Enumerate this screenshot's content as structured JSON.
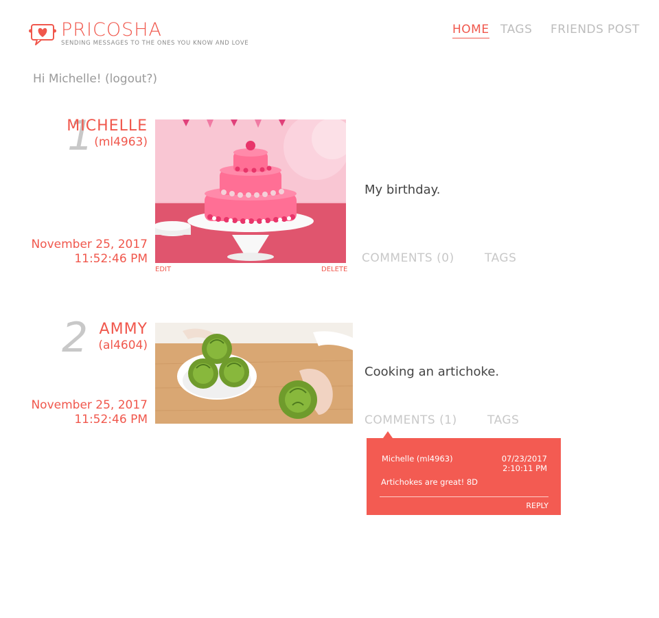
{
  "brand": {
    "name": "PRICOSHA",
    "tagline": "Sending messages to the ones you know and love",
    "icon": "chat-heart-icon",
    "accent_color": "#f0574c"
  },
  "nav": {
    "home": "HOME",
    "tags": "TAGS",
    "friends": "FRIENDS",
    "post": "POST"
  },
  "greeting": {
    "text": "Hi Michelle! ",
    "logout": "(logout?)"
  },
  "posts": [
    {
      "number": "1",
      "name": "MICHELLE",
      "username": "(ml4963)",
      "date": "November 25, 2017",
      "time": "11:52:46 PM",
      "image": "pink-birthday-cake-photo",
      "caption": "My birthday.",
      "edit_label": "EDIT",
      "delete_label": "DELETE",
      "comments_label": "COMMENTS (0)",
      "tags_label": "TAGS"
    },
    {
      "number": "2",
      "name": "AMMY",
      "username": "(al4604)",
      "date": "November 25, 2017",
      "time": "11:52:46 PM",
      "image": "artichokes-cutting-board-photo",
      "caption": "Cooking an artichoke.",
      "comments_label": "COMMENTS (1)",
      "tags_label": "TAGS",
      "comments": [
        {
          "user": "Michelle (ml4963)",
          "date": "07/23/2017",
          "time": "2:10:11 PM",
          "text": "Artichokes are great! 8D",
          "reply_label": "REPLY"
        }
      ]
    }
  ]
}
